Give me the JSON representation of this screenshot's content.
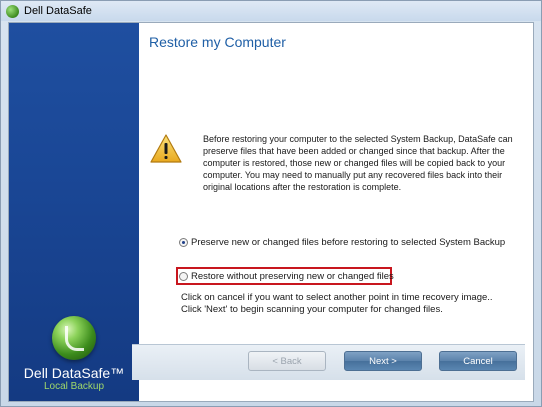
{
  "window": {
    "title": "Dell DataSafe"
  },
  "sidebar": {
    "brand": "Dell DataSafe™",
    "brand_sub": "Local Backup"
  },
  "page": {
    "heading": "Restore my Computer",
    "warning_text": "Before restoring your computer to the selected System Backup, DataSafe can preserve files that have been added or changed since that backup.  After the computer is restored, those new or changed files will be copied back to your computer.  You may need to manually put any recovered files back into their original locations after the restoration is complete.",
    "options": [
      {
        "label": "Preserve new or changed files before restoring to selected System Backup",
        "selected": true
      },
      {
        "label": "Restore without preserving new or changed files",
        "selected": false
      }
    ],
    "hint_line1": "Click on cancel if you want to select another point in time recovery image..",
    "hint_line2": "Click 'Next' to begin scanning your computer for changed files."
  },
  "buttons": {
    "back": "< Back",
    "next": "Next >",
    "cancel": "Cancel"
  },
  "colors": {
    "sidebar_blue": "#1a4796",
    "heading_blue": "#1f5fa6",
    "highlight_red": "#c8161e",
    "brand_green": "#9fd86a"
  },
  "icons": {
    "title": "datasafe-logo-icon",
    "warning": "warning-triangle-icon",
    "brand": "datasafe-orb-icon"
  }
}
